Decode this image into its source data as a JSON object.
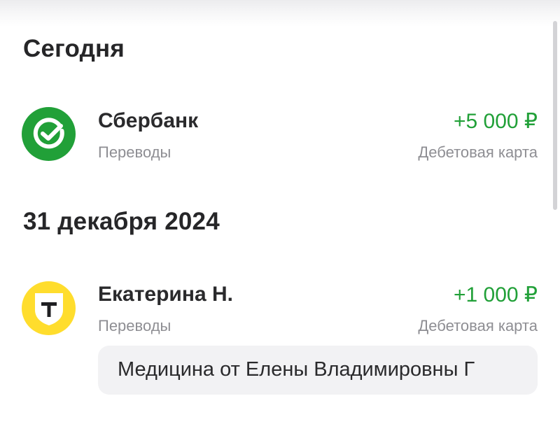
{
  "sections": [
    {
      "title": "Сегодня",
      "transactions": [
        {
          "name": "Сбербанк",
          "category": "Переводы",
          "amount": "+5 000 ₽",
          "account": "Дебетовая карта",
          "icon": "sberbank-logo-icon"
        }
      ]
    },
    {
      "title": "31 декабря 2024",
      "transactions": [
        {
          "name": "Екатерина Н.",
          "category": "Переводы",
          "amount": "+1 000 ₽",
          "account": "Дебетовая карта",
          "icon": "tbank-logo-icon",
          "comment": "Медицина от Елены Владимировны Г"
        }
      ]
    }
  ],
  "colors": {
    "income": "#21a038",
    "secondary_text": "#8e8e93",
    "sber_green": "#21a038",
    "tbank_yellow": "#ffdd2d"
  }
}
